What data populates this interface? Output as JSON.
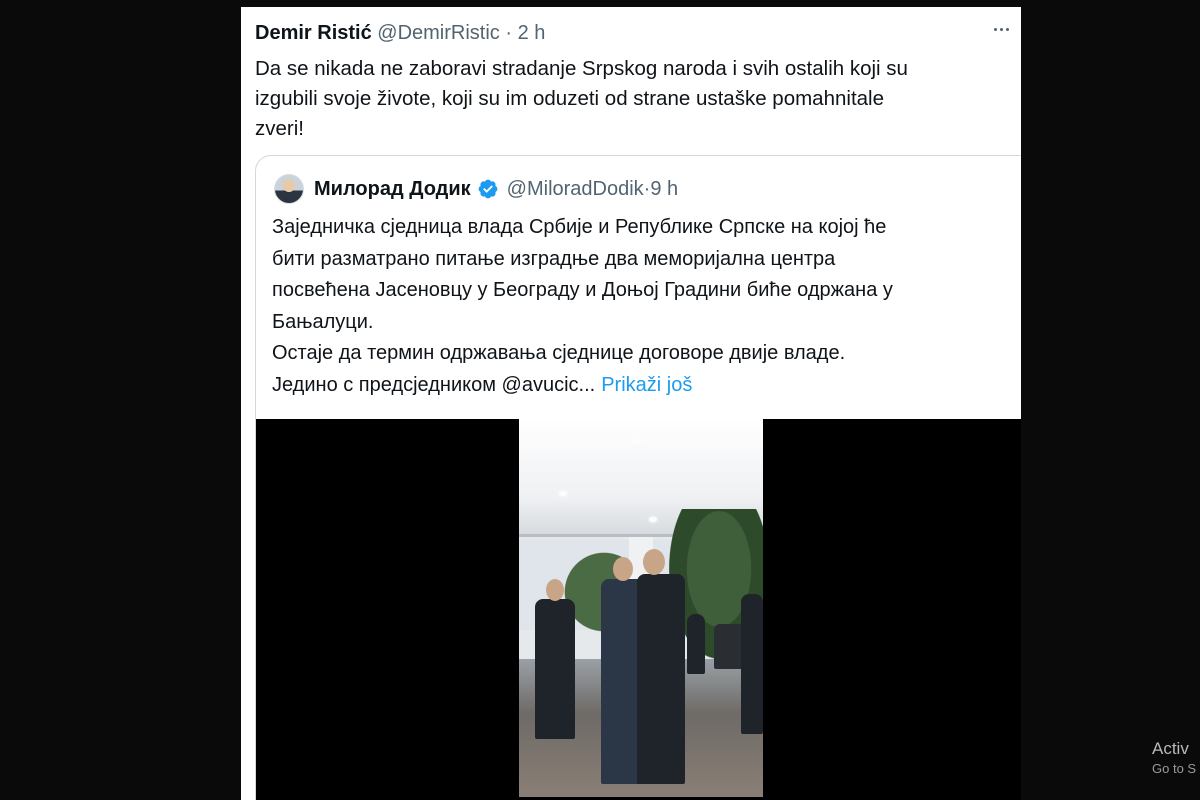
{
  "tweet": {
    "author_name": "Demir Ristić",
    "handle": "@DemirRistic",
    "separator": " · ",
    "time": "2 h",
    "text": "Da se nikada ne zaboravi stradanje Srpskog naroda i svih ostalih koji su\nizgubili svoje živote, koji su im oduzeti  od strane ustaške pomahnitale\nzveri!",
    "more_icon": "more-horizontal-icon"
  },
  "quoted_tweet": {
    "author_name": "Милорад Додик",
    "verified_icon": "verified-badge-icon",
    "verified_color": "#1d9bf0",
    "handle": "@MiloradDodik",
    "separator": " · ",
    "time": "9 h",
    "text": "Заједничка сједница влада Србије и Републике Српске на којој ће\nбити разматрано питање изградње два меморијална центра\nпосвећена Јасеновцу у Београду и Доњој Градини биће одржана у\nБањалуци.\nОстаје да термин одржавања сједнице договоре двије владе.\nЈедино с предсједником @avucic...",
    "show_more": "Prikaži još",
    "link_color": "#1d9bf0"
  },
  "os_watermark": {
    "line1": "Activ",
    "line2": "Go to S"
  }
}
